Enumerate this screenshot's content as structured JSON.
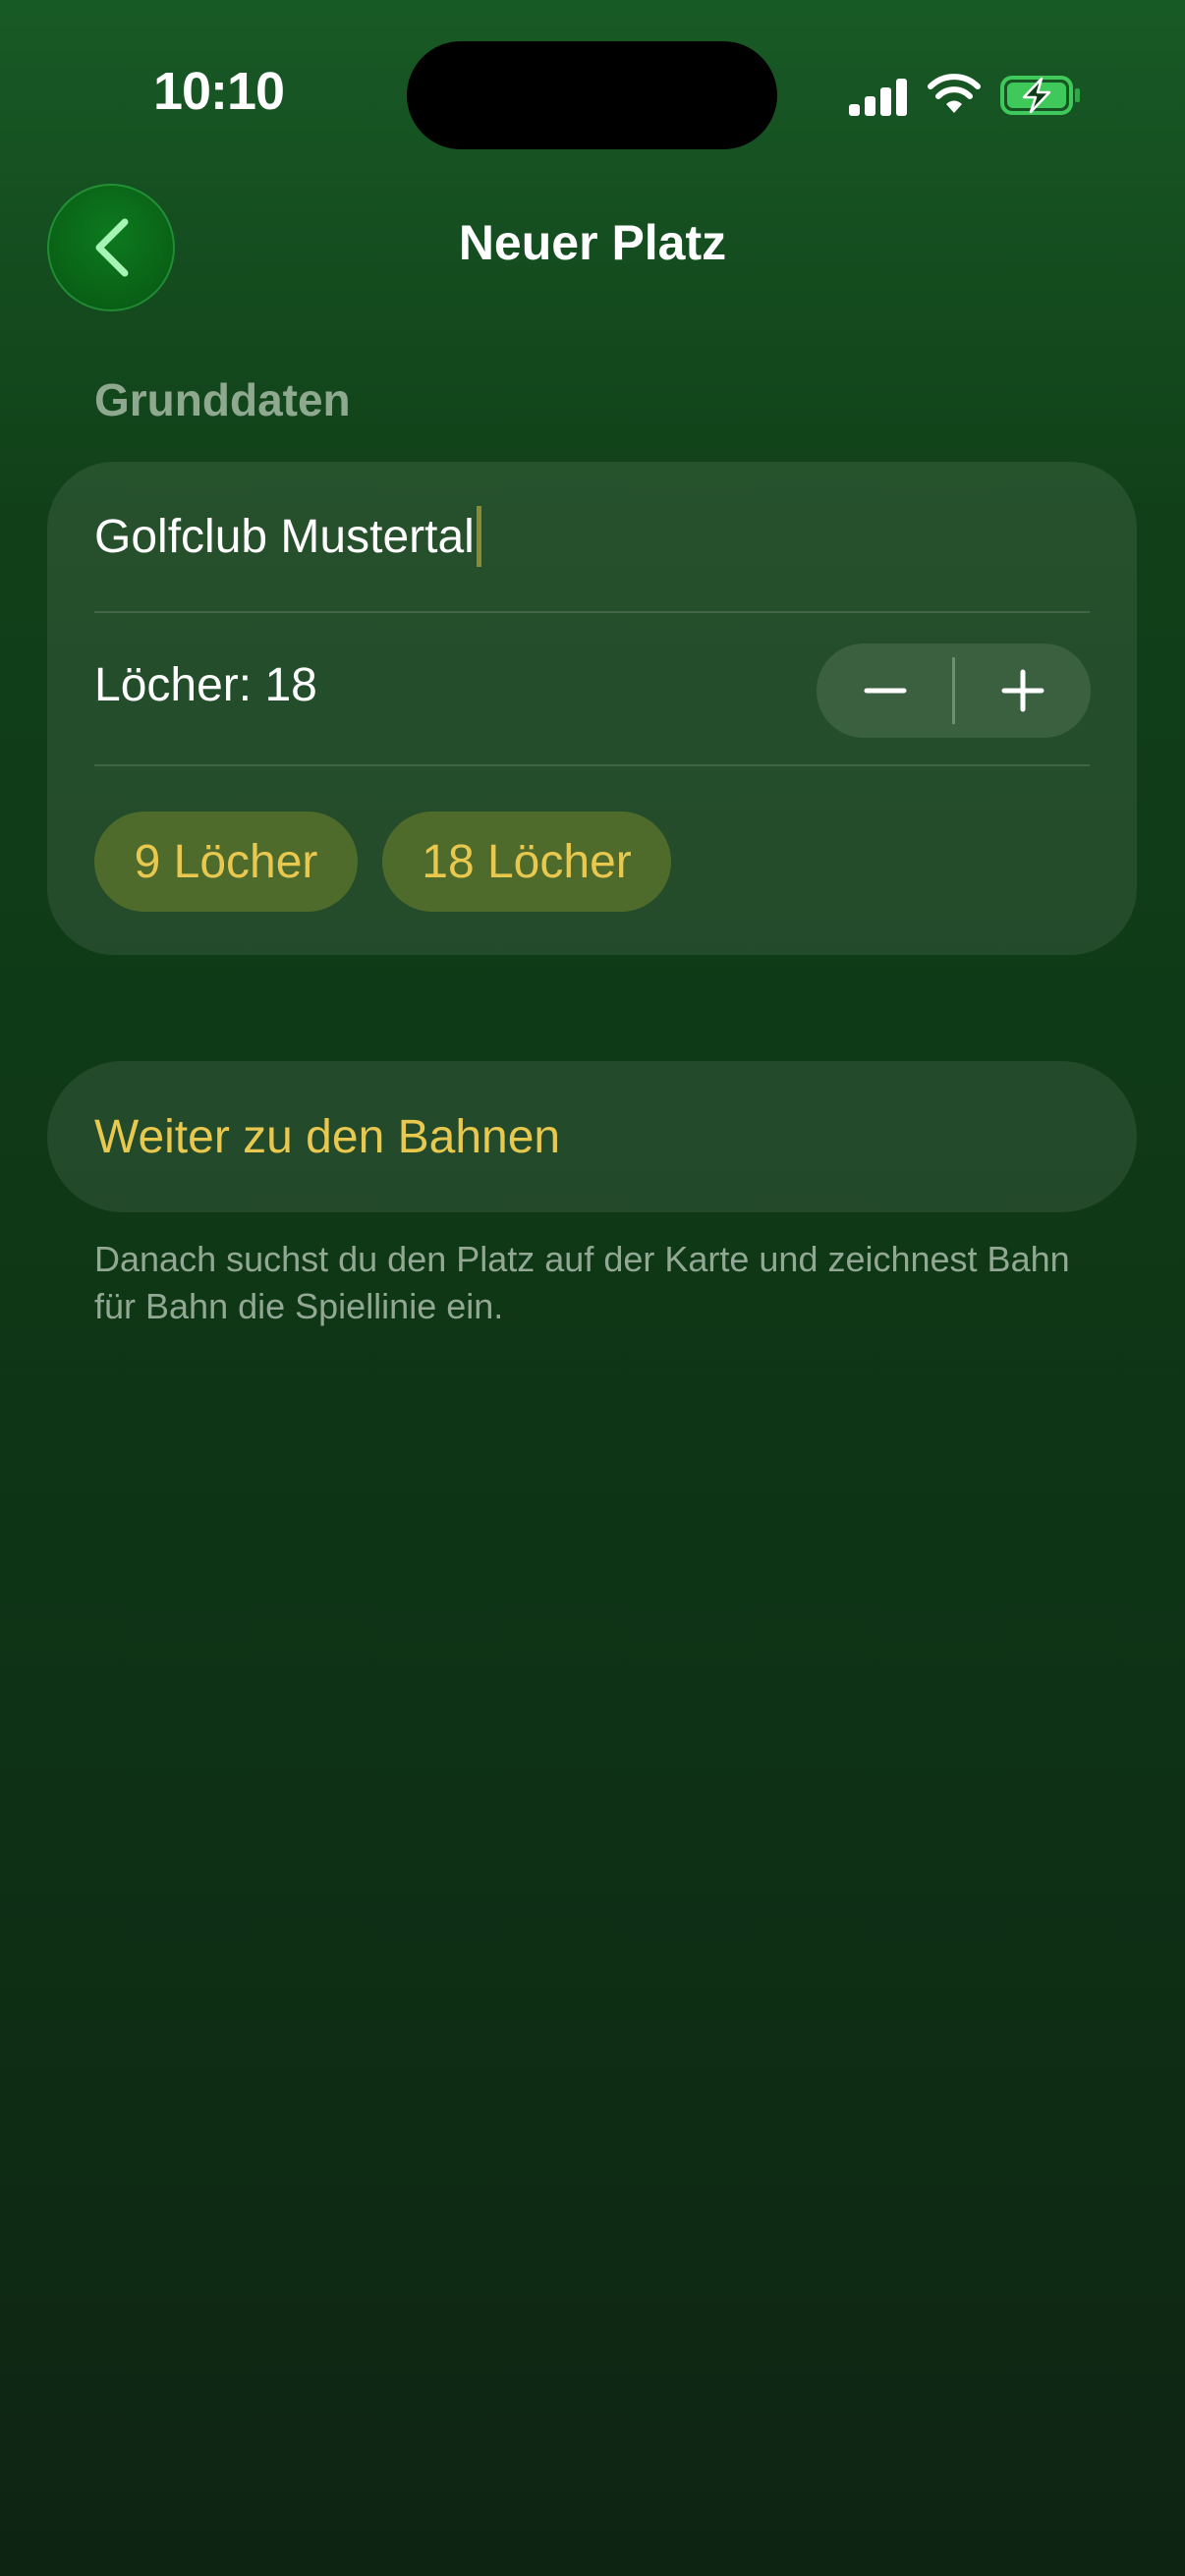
{
  "status_bar": {
    "time": "10:10",
    "icons": [
      "signal-icon",
      "wifi-icon",
      "battery-charging-icon"
    ]
  },
  "nav": {
    "back_icon": "chevron-left-icon",
    "title": "Neuer Platz"
  },
  "form": {
    "section_header": "Grunddaten",
    "course_name": "Golfclub Mustertal",
    "holes_label": "Löcher: 18",
    "holes_count": 18,
    "stepper": {
      "minus_icon": "minus-icon",
      "plus_icon": "plus-icon"
    },
    "presets": [
      "9 Löcher",
      "18 Löcher"
    ]
  },
  "continue_button": {
    "label": "Weiter zu den Bahnen"
  },
  "footnote": "Danach suchst du den Platz auf der Karte und zeichnest Bahn für Bahn die Spiellinie ein.",
  "colors": {
    "accent_yellow": "#e8c84f",
    "chip_background": "#4f6b2b",
    "back_button_green": "#096016",
    "background_top": "#185a26",
    "background_bottom": "#0e2413"
  }
}
